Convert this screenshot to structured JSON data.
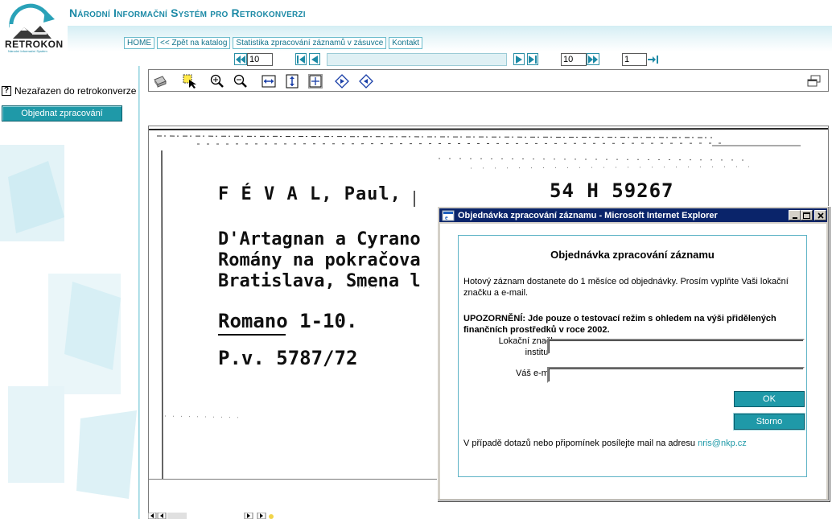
{
  "header": {
    "logo_text": "RETROKON",
    "logo_subtitle": "Národní Informační Systém",
    "site_title": "Národní Informační Systém pro Retrokonverzi",
    "nav": [
      "HOME",
      "<< Zpět na katalog",
      "Statistika zpracování záznamů v zásuvce",
      "Kontakt"
    ]
  },
  "paging": {
    "back_count": "10",
    "forward_count": "10",
    "current_page": "1"
  },
  "sidebar": {
    "status_icon": "?",
    "status_text": "Nezařazen do retrokonverze",
    "order_button": "Objednat zpracování"
  },
  "toolbar": {
    "icons": [
      "print-icon",
      "select-icon",
      "zoom-in-icon",
      "zoom-out-icon",
      "fit-width-icon",
      "fit-height-icon",
      "fit-page-icon",
      "rotate-right-icon",
      "rotate-left-icon",
      "restore-window-icon"
    ]
  },
  "card": {
    "line1_name": "F É V A L,  Paul,",
    "line1_signature": "54 H 59267",
    "line2": "D'Artagnan a Cyrano",
    "line3": "Romány na pokračova",
    "line4": "Bratislava, Smena l",
    "line5": "Romano 1-10.",
    "line6": "P.v. 5787/72"
  },
  "dialog": {
    "window_title": "Objednávka zpracování záznamu - Microsoft Internet Explorer",
    "heading": "Objednávka zpracování záznamu",
    "intro": "Hotový záznam dostanete do 1 měsíce od objednávky. Prosím vyplňte Vaši lokační značku a e-mail.",
    "warning": "UPOZORNĚNÍ: Jde pouze o testovací režim s ohledem na výši přidělených finančních prostředků v roce 2002.",
    "label_location_line1": "Lokační značka",
    "label_location_line2": "instituce:",
    "label_email": "Váš e-mail:",
    "location_value": "",
    "email_value": "",
    "ok_button": "OK",
    "cancel_button": "Storno",
    "footer_text": "V případě dotazů nebo připomínek posílejte mail na adresu",
    "footer_email": "nris@nkp.cz"
  },
  "colors": {
    "accent": "#1f99a8",
    "title_text": "#1d8aa6",
    "ie_titlebar": "#0a246a"
  }
}
